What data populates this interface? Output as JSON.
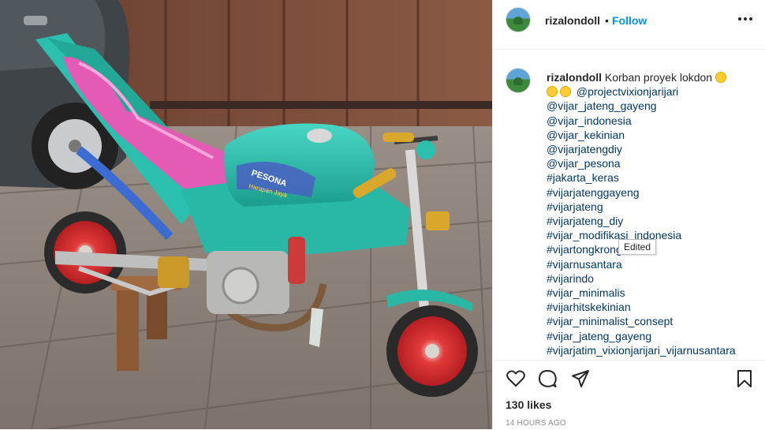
{
  "post": {
    "username": "rizalondoll",
    "separator": "•",
    "follow_label": "Follow",
    "more_icon": "more-horizontal-icon",
    "caption_text": "Korban proyek lokdon",
    "caption_mentions": [
      "@projectvixionjarijari",
      "@vijar_jateng_gayeng",
      "@vijar_indonesia",
      "@vijar_kekinian",
      "@vijarjatengdiy",
      "@vijar_pesona",
      "#jakarta_keras",
      "#vijarjatenggayeng",
      "#vijarjateng",
      "#vijarjateng_diy",
      "#vijar_modifikasi_indonesia",
      "#vijartongkrongan",
      "#vijarnusantara",
      "#vijarindo",
      "#vijar_minimalis",
      "#vijarhitskekinian",
      "#vijar_minimalist_consept",
      "#vijar_jateng_gayeng",
      "#vijarjatim_vixionjarijari_vijarnusantara"
    ],
    "tooltip": "Edited",
    "likes": "130 likes",
    "timestamp": "14 HOURS AGO"
  },
  "photo": {
    "tank_text_1": "PESONA",
    "tank_text_2": "Harapan Jaya",
    "seat_badge": "PESONA"
  },
  "colors": {
    "link": "#00376b",
    "follow": "#0095f6",
    "bike_body": "#2bbfae",
    "seat": "#e35bb4",
    "wheel_rim": "#d7262a"
  },
  "icons": [
    "heart-icon",
    "comment-icon",
    "share-icon",
    "bookmark-icon"
  ]
}
